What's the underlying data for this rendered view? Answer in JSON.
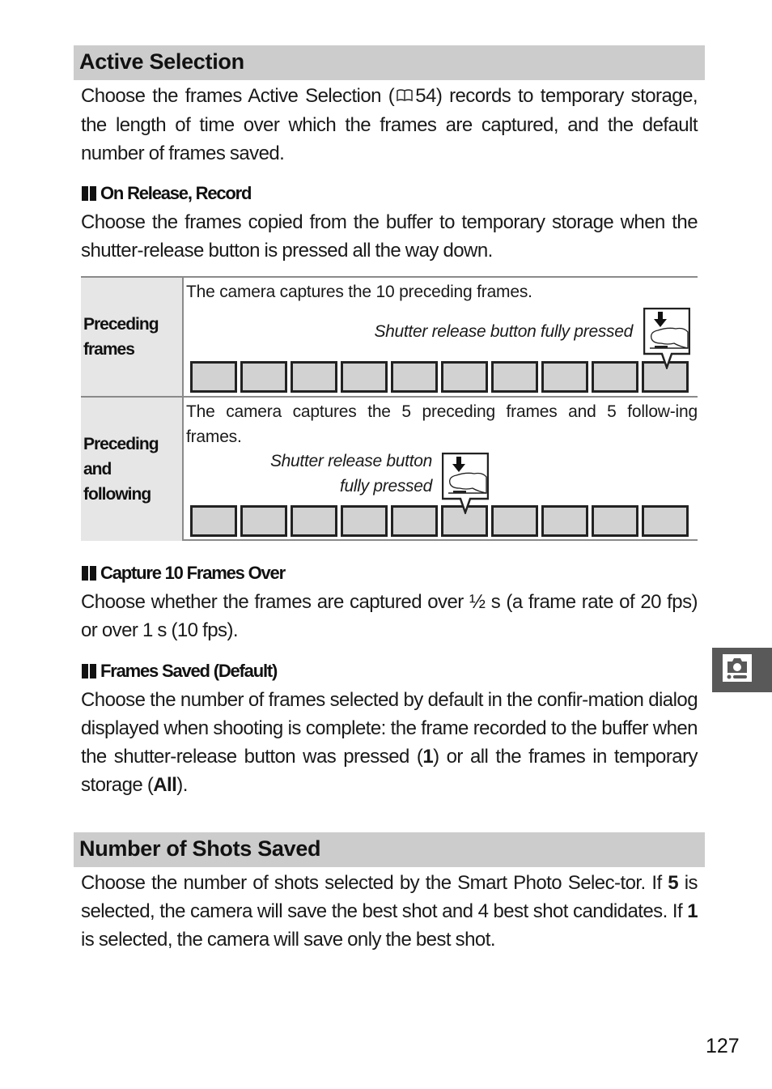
{
  "sections": {
    "active_selection": {
      "title": "Active Selection",
      "intro": "Choose the frames Active Selection (🕮 54) records to temporary storage, the length of time over which the frames are captured, and the default number of frames saved.",
      "intro_parts": {
        "before_ref": "Choose the frames Active Selection (",
        "ref_icon": "book-reference-icon",
        "ref_page": "54",
        "after_ref": ") records to temporary storage, the length of time over which the frames are captured, and the default number of frames saved."
      },
      "on_release": {
        "heading": "On Release, Record",
        "body": "Choose the frames copied from the buffer to temporary storage when the shutter-release button is pressed all the way down.",
        "table": {
          "rows": [
            {
              "label": "Preceding\nframes",
              "description": "The camera captures the 10 preceding frames.",
              "caption": "Shutter release button fully pressed",
              "frame_count": 10,
              "pressed_frame_index": 10
            },
            {
              "label": "Preceding\nand\nfollowing",
              "description": "The camera captures the 5 preceding frames and 5 follow-ing frames.",
              "caption": "Shutter release button\nfully pressed",
              "frame_count": 10,
              "pressed_frame_index": 6
            }
          ]
        }
      },
      "capture_over": {
        "heading": "Capture 10 Frames Over",
        "body": "Choose whether the frames are captured over ½ s (a frame rate of 20 fps) or over 1 s (10 fps)."
      },
      "frames_saved": {
        "heading": "Frames Saved (Default)",
        "body_1": "Choose the number of frames selected by default in the confir-mation dialog displayed when shooting is complete: the frame recorded to the buffer when the shutter-release button was pressed (",
        "bold_1": "1",
        "body_2": ") or all the frames in temporary storage (",
        "bold_2": "All",
        "body_3": ")."
      }
    },
    "number_of_shots": {
      "title": "Number of Shots Saved",
      "body_1": "Choose the number of shots selected by the Smart Photo Selec-tor. If ",
      "bold_1": "5",
      "body_2": " is selected, the camera will save the best shot and 4 best shot candidates. If ",
      "bold_2": "1",
      "body_3": " is selected, the camera will save only the best shot."
    }
  },
  "side_tab": {
    "icon": "camera-shooting-menu-icon"
  },
  "page_number": "127"
}
